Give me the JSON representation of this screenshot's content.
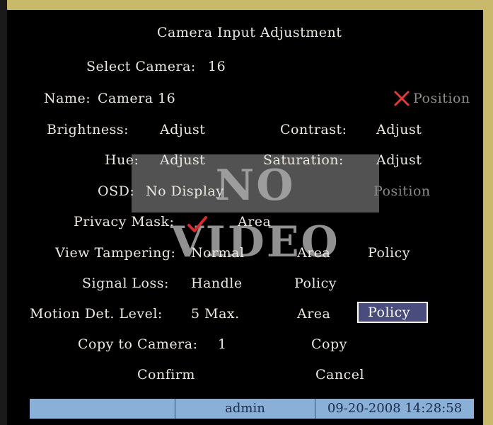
{
  "title": "Camera Input Adjustment",
  "select_camera": {
    "label": "Select Camera:",
    "value": "16"
  },
  "name": {
    "label": "Name:",
    "value": "Camera 16",
    "position_label": "Position"
  },
  "brightness": {
    "label": "Brightness:",
    "value": "Adjust"
  },
  "contrast": {
    "label": "Contrast:",
    "value": "Adjust"
  },
  "hue": {
    "label": "Hue:",
    "value": "Adjust"
  },
  "saturation": {
    "label": "Saturation:",
    "value": "Adjust"
  },
  "osd": {
    "label": "OSD:",
    "value": "No Display",
    "position_label": "Position"
  },
  "no_video": "NO VIDEO",
  "privacy_mask": {
    "label": "Privacy Mask:",
    "area_label": "Area",
    "checked": true
  },
  "view_tampering": {
    "label": "View Tampering:",
    "value": "Normal",
    "area_label": "Area",
    "policy_label": "Policy"
  },
  "signal_loss": {
    "label": "Signal Loss:",
    "value": "Handle",
    "policy_label": "Policy"
  },
  "motion_det": {
    "label": "Motion Det. Level:",
    "value": "5 Max.",
    "area_label": "Area",
    "policy_label": "Policy"
  },
  "copy_to_camera": {
    "label": "Copy to Camera:",
    "value": "1",
    "copy_label": "Copy"
  },
  "confirm_label": "Confirm",
  "cancel_label": "Cancel",
  "status": {
    "user": "admin",
    "datetime": "09-20-2008 14:28:58"
  },
  "colors": {
    "background": "#000000",
    "text": "#ece7e0",
    "highlight": "#f2e6a0",
    "selected_bg": "#4b4c7e",
    "statusbar": "#8ab0d8",
    "disabled_mark": "#e23a3a",
    "check_mark": "#d92b2b"
  }
}
